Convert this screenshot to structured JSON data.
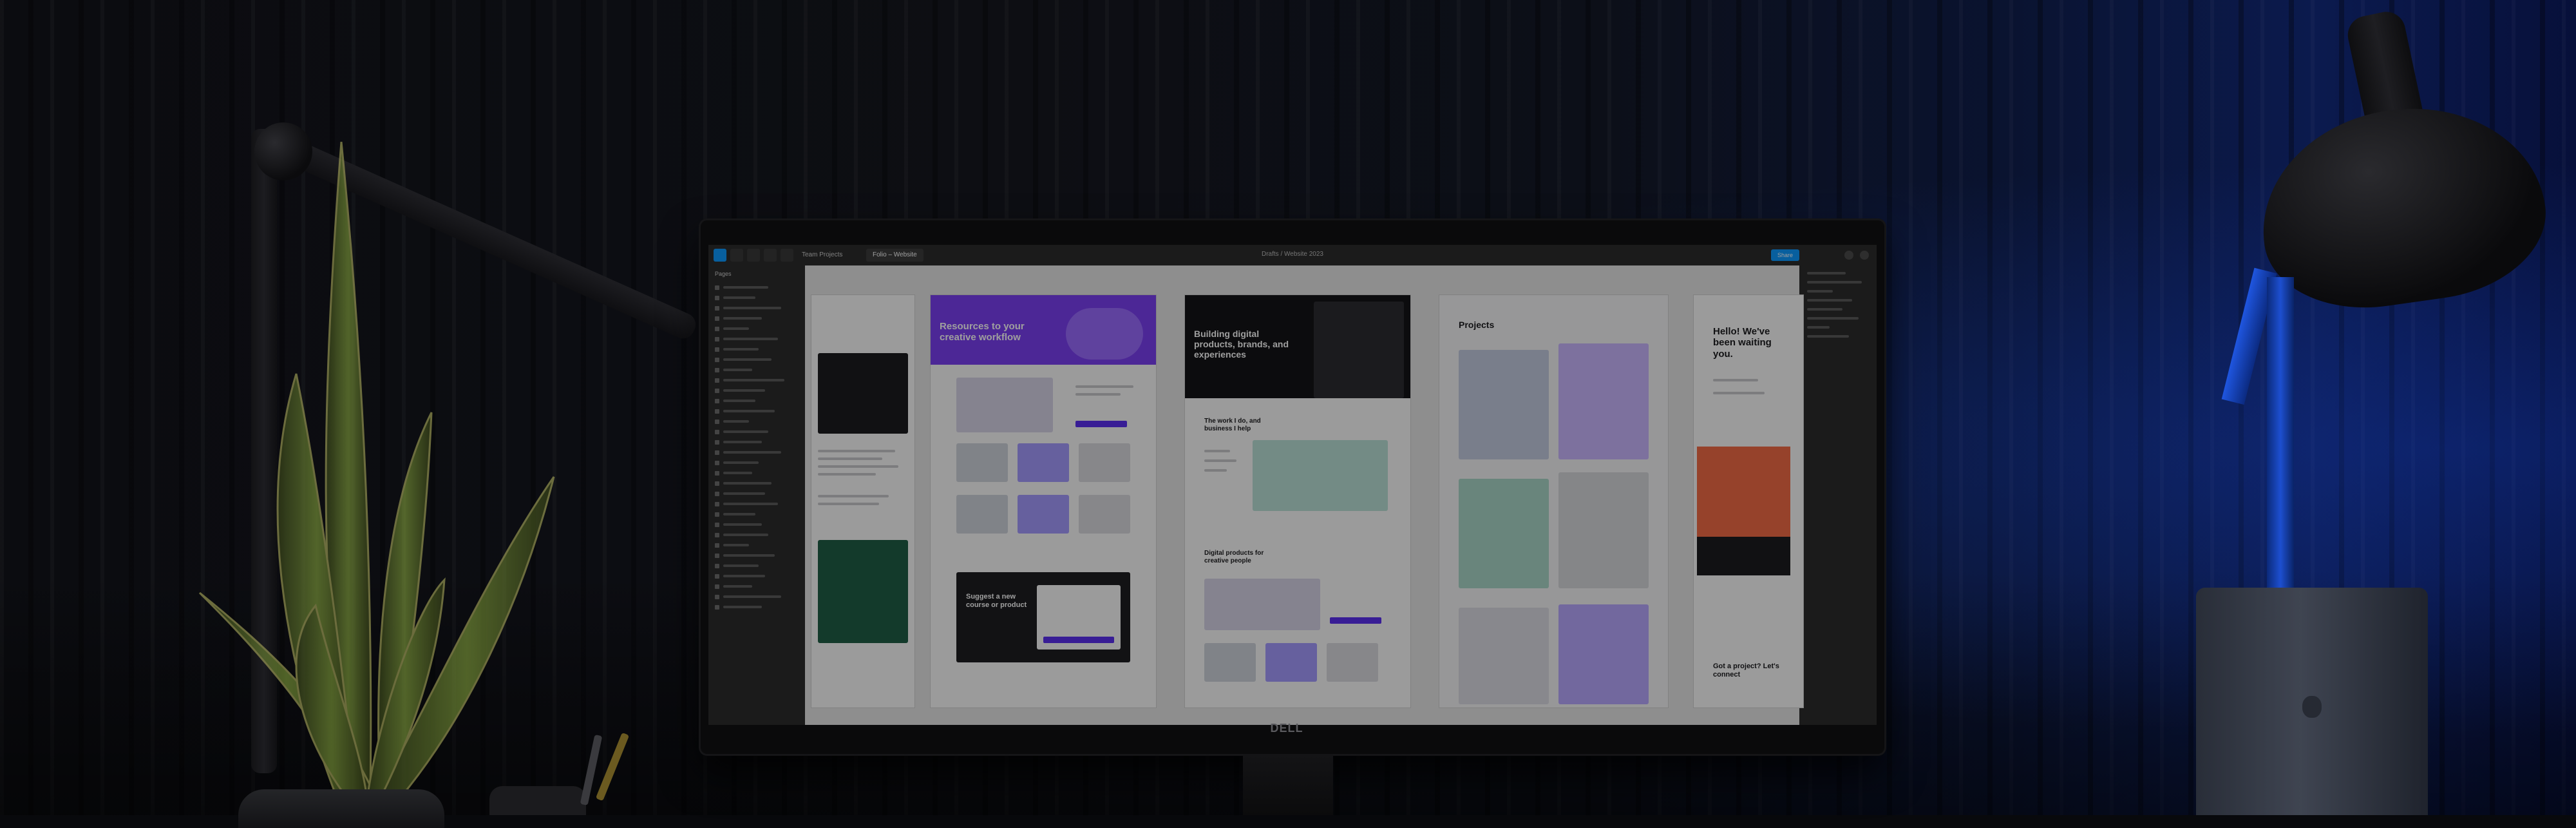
{
  "figma": {
    "tabs": [
      "Team Projects",
      "Folio – Website"
    ],
    "file_title": "Drafts / Website 2023",
    "share_label": "Share",
    "layers_header": "Pages"
  },
  "frames": {
    "f2_hero": "Resources to your creative workflow",
    "f2_cta": "Suggest a new course or product",
    "f3_hero": "Building digital products, brands, and experiences",
    "f3_section": "The work I do, and business I help",
    "f3_products": "Digital products for creative people",
    "f4_title": "Projects",
    "f5_hello": "Hello! We've been waiting you.",
    "f5_cta": "Got a project? Let's connect"
  },
  "monitor_brand": "DELL",
  "colors": {
    "figma_blue": "#0d99ff",
    "accent_purple": "#5b2ff0",
    "accent_orange": "#f26a45",
    "accent_green": "#1f5e46"
  }
}
